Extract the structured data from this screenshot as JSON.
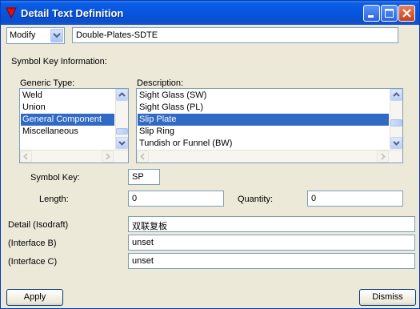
{
  "window": {
    "title": "Detail Text Definition"
  },
  "mode": {
    "selected": "Modify"
  },
  "detail_name": {
    "value": "Double-Plates-SDTE"
  },
  "section": {
    "symbol_key_info": "Symbol Key Information:"
  },
  "generic_type": {
    "label": "Generic Type:",
    "items": [
      "Weld",
      "Union",
      "General Component",
      "Miscellaneous"
    ],
    "selected": "General Component"
  },
  "description": {
    "label": "Description:",
    "items": [
      "Sight Glass (SW)",
      "Sight Glass (PL)",
      "Slip Plate",
      "Slip Ring",
      "Tundish or Funnel (BW)"
    ],
    "selected": "Slip Plate"
  },
  "symbol_key": {
    "label": "Symbol Key:",
    "value": "SP"
  },
  "length": {
    "label": "Length:",
    "value": "0"
  },
  "quantity": {
    "label": "Quantity:",
    "value": "0"
  },
  "detail_isodraft": {
    "label": "Detail (Isodraft)",
    "value": "双联复板"
  },
  "interface_b": {
    "label": "(Interface B)",
    "value": "unset"
  },
  "interface_c": {
    "label": "(Interface C)",
    "value": "unset"
  },
  "buttons": {
    "apply": "Apply",
    "dismiss": "Dismiss"
  },
  "icons": {
    "app": "red-triangle-icon",
    "minimize": "minimize-icon",
    "maximize": "maximize-icon",
    "close": "close-icon",
    "combo": "chevron-down-icon"
  },
  "colors": {
    "titlebar": "#0654dc",
    "selection": "#316ac5",
    "dialog_bg": "#ece9d8",
    "field_border": "#7f9db9"
  }
}
